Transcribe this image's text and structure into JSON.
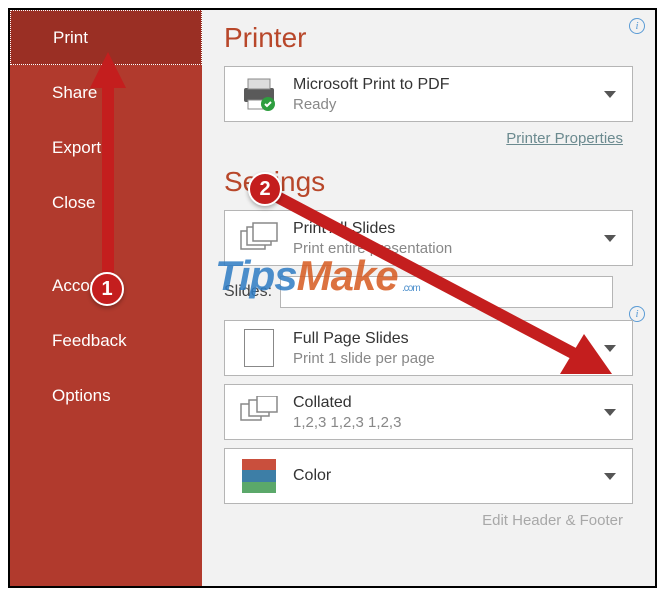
{
  "sidebar": {
    "items": [
      {
        "label": "Print"
      },
      {
        "label": "Share"
      },
      {
        "label": "Export"
      },
      {
        "label": "Close"
      },
      {
        "label": "Account"
      },
      {
        "label": "Feedback"
      },
      {
        "label": "Options"
      }
    ]
  },
  "printer": {
    "heading": "Printer",
    "selected": {
      "name": "Microsoft Print to PDF",
      "status": "Ready"
    },
    "properties_link": "Printer Properties"
  },
  "settings": {
    "heading": "Settings",
    "print_range": {
      "title": "Print All Slides",
      "sub": "Print entire presentation"
    },
    "slides_label": "Slides:",
    "slides_value": "",
    "layout": {
      "title": "Full Page Slides",
      "sub": "Print 1 slide per page"
    },
    "collate": {
      "title": "Collated",
      "sub": "1,2,3    1,2,3    1,2,3"
    },
    "color": {
      "title": "Color"
    },
    "footer": "Edit Header & Footer"
  },
  "annotations": {
    "step1": "1",
    "step2": "2"
  },
  "watermark": {
    "t": "Tips",
    "m": "Make",
    "sub": ".com"
  }
}
